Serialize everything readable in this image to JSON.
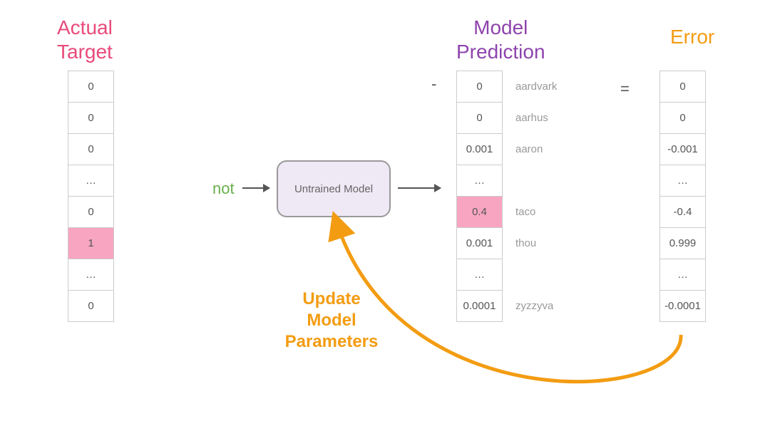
{
  "headers": {
    "actual_target": "Actual\nTarget",
    "model_prediction": "Model\nPrediction",
    "error": "Error"
  },
  "input_token": "not",
  "model_label": "Untrained Model",
  "operators": {
    "minus": "-",
    "equals": "="
  },
  "update_label": "Update\nModel\nParameters",
  "target_vector": [
    {
      "v": "0",
      "hl": false
    },
    {
      "v": "0",
      "hl": false
    },
    {
      "v": "0",
      "hl": false
    },
    {
      "v": "…",
      "hl": false
    },
    {
      "v": "0",
      "hl": false
    },
    {
      "v": "1",
      "hl": true
    },
    {
      "v": "…",
      "hl": false
    },
    {
      "v": "0",
      "hl": false
    }
  ],
  "prediction_vector": [
    {
      "v": "0",
      "hl": false,
      "word": "aardvark"
    },
    {
      "v": "0",
      "hl": false,
      "word": "aarhus"
    },
    {
      "v": "0.001",
      "hl": false,
      "word": "aaron"
    },
    {
      "v": "…",
      "hl": false,
      "word": ""
    },
    {
      "v": "0.4",
      "hl": true,
      "word": "taco"
    },
    {
      "v": "0.001",
      "hl": false,
      "word": "thou"
    },
    {
      "v": "…",
      "hl": false,
      "word": ""
    },
    {
      "v": "0.0001",
      "hl": false,
      "word": "zyzzyva"
    }
  ],
  "error_vector": [
    {
      "v": "0"
    },
    {
      "v": "0"
    },
    {
      "v": "-0.001"
    },
    {
      "v": "…"
    },
    {
      "v": "-0.4"
    },
    {
      "v": "0.999"
    },
    {
      "v": "…"
    },
    {
      "v": "-0.0001"
    }
  ],
  "colors": {
    "pink": "#e84a7a",
    "purple": "#8e44ad",
    "orange": "#f39c12",
    "green": "#6ab04c",
    "highlight": "#f8a5c2"
  }
}
